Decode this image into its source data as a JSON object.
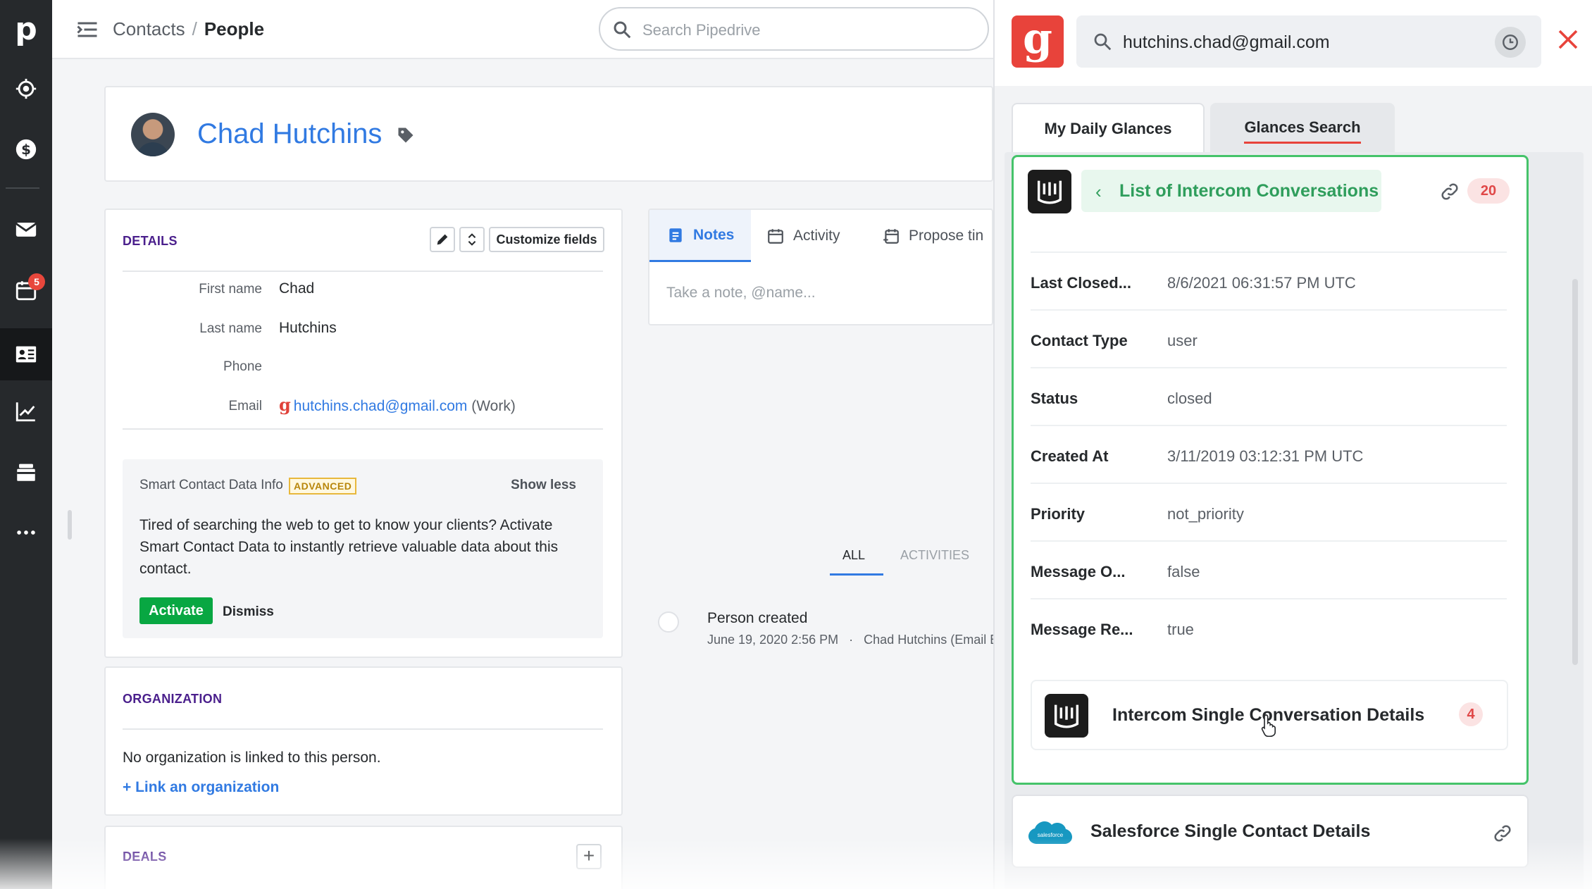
{
  "nav": {
    "logo": "p",
    "items": [
      {
        "icon": "target-icon"
      },
      {
        "icon": "dollar-icon"
      },
      {
        "icon": "mail-icon"
      },
      {
        "icon": "calendar-icon",
        "badge": "5"
      },
      {
        "icon": "contacts-icon",
        "active": true
      },
      {
        "icon": "chart-icon"
      },
      {
        "icon": "products-icon"
      },
      {
        "icon": "more-icon"
      }
    ]
  },
  "header": {
    "breadcrumb_parent": "Contacts",
    "breadcrumb_sep": "/",
    "breadcrumb_current": "People",
    "search_placeholder": "Search Pipedrive"
  },
  "person": {
    "name": "Chad Hutchins"
  },
  "details": {
    "title": "DETAILS",
    "customize_label": "Customize fields",
    "fields": {
      "first_name_label": "First name",
      "first_name": "Chad",
      "last_name_label": "Last name",
      "last_name": "Hutchins",
      "phone_label": "Phone",
      "phone": "",
      "email_label": "Email",
      "email": "hutchins.chad@gmail.com",
      "email_type": "(Work)"
    },
    "smart_data": {
      "title": "Smart Contact Data Info",
      "badge": "ADVANCED",
      "toggle": "Show less",
      "text": "Tired of searching the web to get to know your clients? Activate Smart Contact Data to instantly retrieve valuable data about this contact.",
      "activate": "Activate",
      "dismiss": "Dismiss"
    }
  },
  "organization": {
    "title": "ORGANIZATION",
    "empty_text": "No organization is linked to this person.",
    "link_text": "+ Link an organization"
  },
  "deals": {
    "title": "DEALS",
    "add": "+"
  },
  "notes": {
    "tabs": [
      "Notes",
      "Activity",
      "Propose tin"
    ],
    "placeholder": "Take a note, @name..."
  },
  "history": {
    "tabs": [
      "ALL",
      "ACTIVITIES"
    ],
    "event_title": "Person created",
    "event_date": "June 19, 2020 2:56 PM",
    "event_sep": "·",
    "event_by": "Chad Hutchins (Email E"
  },
  "glance": {
    "logo": "g",
    "search_value": "hutchins.chad@gmail.com",
    "tabs": [
      "My Daily Glances",
      "Glances Search"
    ],
    "list_title": "List of Intercom Conversations",
    "list_count": "20",
    "rows": [
      {
        "key": "Last Closed...",
        "value": "8/6/2021 06:31:57 PM UTC"
      },
      {
        "key": "Contact Type",
        "value": "user"
      },
      {
        "key": "Status",
        "value": "closed"
      },
      {
        "key": "Created At",
        "value": "3/11/2019 03:12:31 PM UTC"
      },
      {
        "key": "Priority",
        "value": "not_priority"
      },
      {
        "key": "Message O...",
        "value": "false"
      },
      {
        "key": "Message Re...",
        "value": "true"
      }
    ],
    "sub_title": "Intercom Single Conversation Details",
    "sub_count": "4",
    "salesforce_title": "Salesforce Single Contact Details",
    "salesforce_logo_text": "salesforce",
    "colors": {
      "brand": "#e8433b",
      "accent": "#45c36a",
      "link": "#317ae2"
    }
  }
}
